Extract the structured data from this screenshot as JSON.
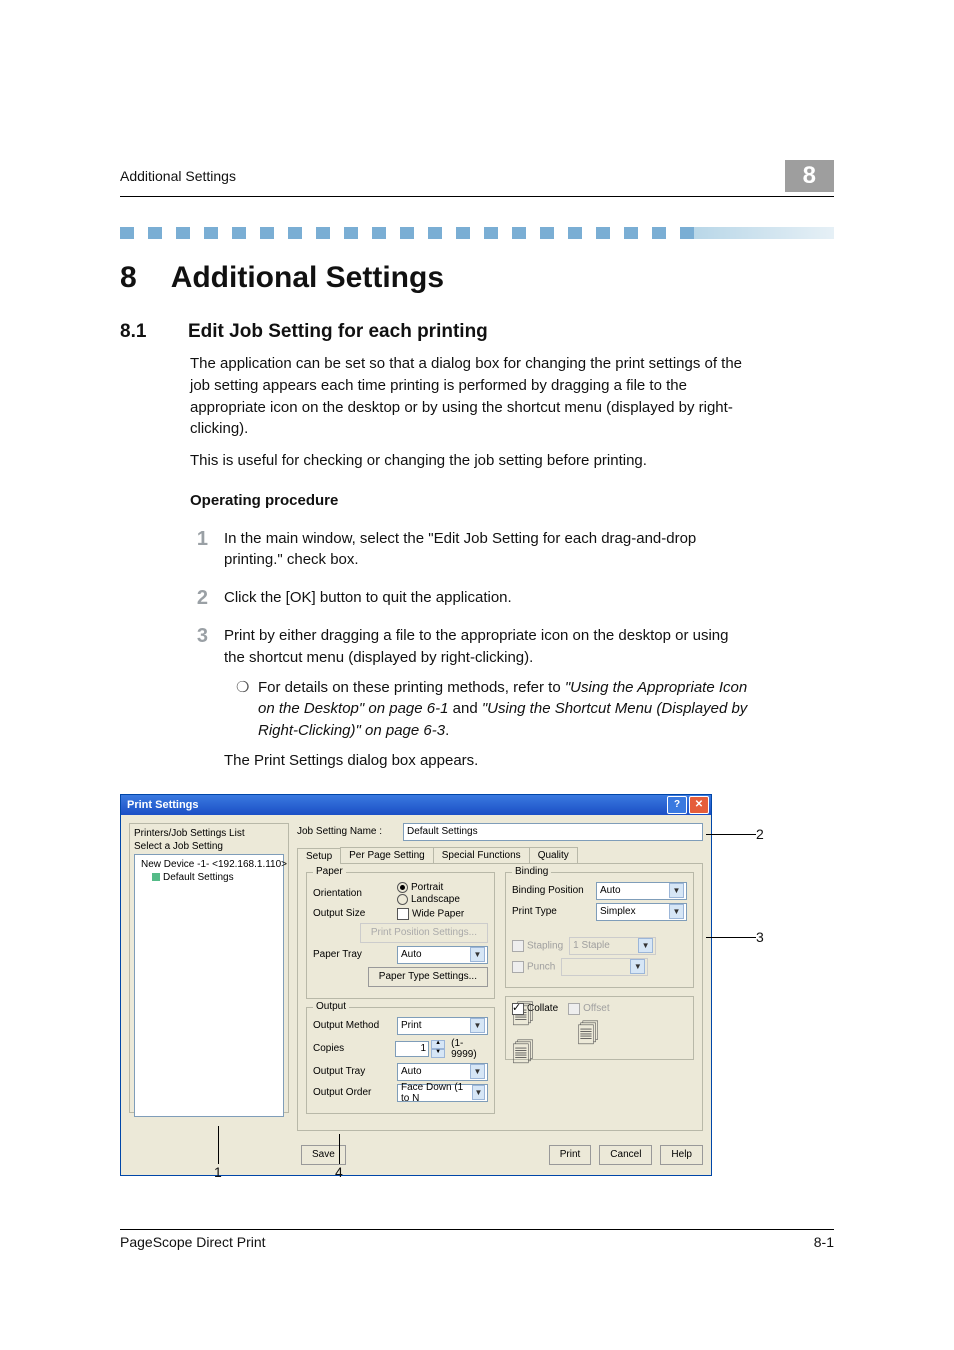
{
  "header": {
    "running_title": "Additional Settings",
    "chapter_badge": "8"
  },
  "h1": {
    "number": "8",
    "text": "Additional Settings"
  },
  "h2": {
    "number": "8.1",
    "text": "Edit Job Setting for each printing"
  },
  "paragraphs": {
    "intro1": "The application can be set so that a dialog box for changing the print settings of the job setting appears each time printing is performed by dragging a file to the appropriate icon on the desktop or by using the shortcut menu (displayed by right-clicking).",
    "intro2": "This is useful for checking or changing the job setting before printing."
  },
  "operating_heading": "Operating procedure",
  "steps": [
    {
      "num": "1",
      "text": "In the main window, select the \"Edit Job Setting for each drag-and-drop printing.\" check box."
    },
    {
      "num": "2",
      "text": "Click the [OK] button to quit the application."
    },
    {
      "num": "3",
      "text": "Print by either dragging a file to the appropriate icon on the desktop or using the shortcut menu (displayed by right-clicking).",
      "sub": {
        "bullet": "❍",
        "pre": "For details on these printing methods, refer to ",
        "ref1": "\"Using the Appropriate Icon on the Desktop\" on page 6-1",
        "mid": " and ",
        "ref2": "\"Using the Shortcut Menu (Displayed by Right-Clicking)\" on page 6-3",
        "post": "."
      },
      "after": "The Print Settings dialog box appears."
    }
  ],
  "dialog": {
    "title": "Print Settings",
    "help_btn": "?",
    "close_btn": "✕",
    "left_title": "Printers/Job Settings List",
    "select_label": "Select a Job Setting",
    "tree_top": "New Device -1- <192.168.1.110>",
    "tree_child": "Default Settings",
    "job_name_label": "Job Setting Name :",
    "job_name_value": "Default Settings",
    "tabs": [
      "Setup",
      "Per Page Setting",
      "Special Functions",
      "Quality"
    ],
    "paper_legend": "Paper",
    "orientation_label": "Orientation",
    "orientation_portrait": "Portrait",
    "orientation_landscape": "Landscape",
    "output_size_label": "Output Size",
    "wide_paper": "Wide Paper",
    "print_pos_btn": "Print Position Settings...",
    "paper_tray_label": "Paper Tray",
    "paper_tray_value": "Auto",
    "paper_type_btn": "Paper Type Settings...",
    "output_legend": "Output",
    "output_method_label": "Output Method",
    "output_method_value": "Print",
    "copies_label": "Copies",
    "copies_value": "1",
    "copies_range": "(1-9999)",
    "output_tray_label": "Output Tray",
    "output_tray_value": "Auto",
    "output_order_label": "Output Order",
    "output_order_value": "Face Down (1 to N",
    "binding_legend": "Binding",
    "binding_pos_label": "Binding Position",
    "binding_pos_value": "Auto",
    "print_type_label": "Print Type",
    "print_type_value": "Simplex",
    "stapling_label": "Stapling",
    "stapling_value": "1 Staple",
    "punch_label": "Punch",
    "collate_label": "Collate",
    "offset_label": "Offset",
    "buttons": {
      "save": "Save",
      "print": "Print",
      "cancel": "Cancel",
      "help": "Help"
    }
  },
  "callouts": {
    "c1": "1",
    "c2": "2",
    "c3": "3",
    "c4": "4"
  },
  "footer": {
    "left": "PageScope Direct Print",
    "right": "8-1"
  }
}
